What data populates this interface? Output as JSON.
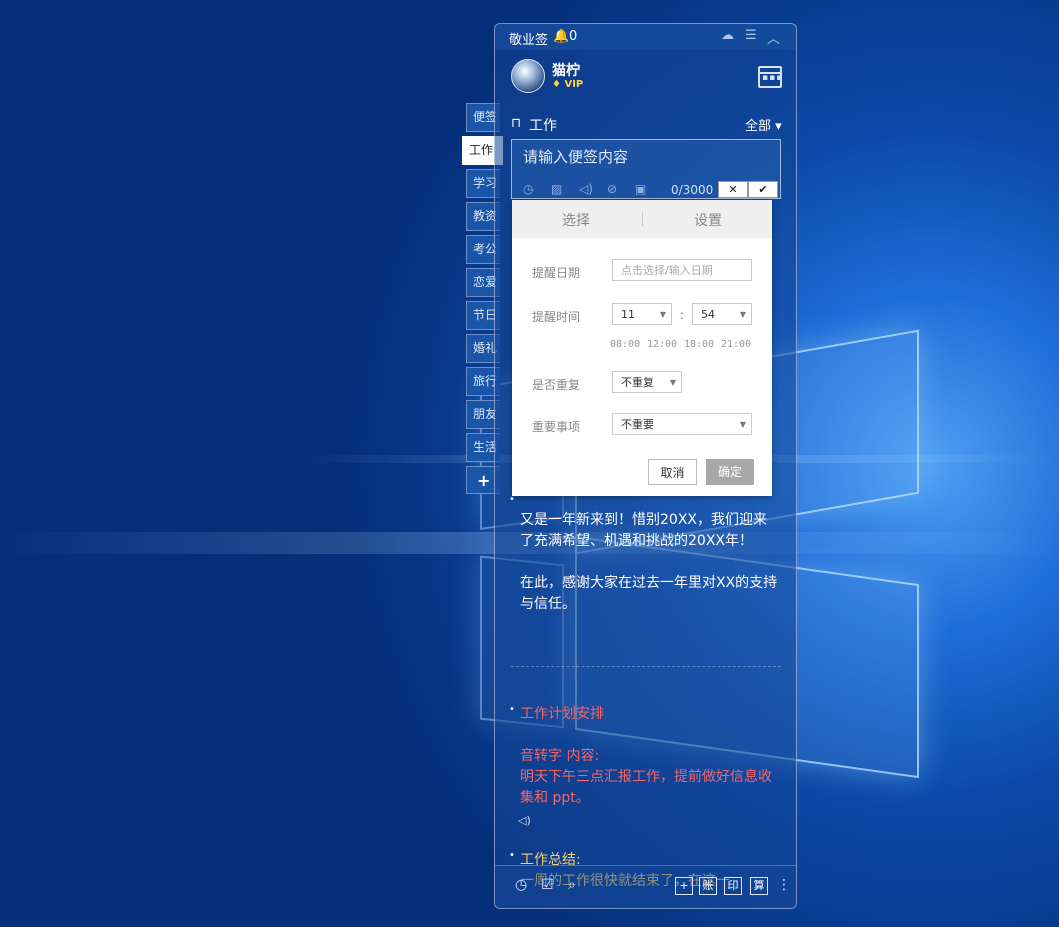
{
  "app": {
    "name": "敬业签",
    "notify_count": "0"
  },
  "user": {
    "name": "猫柠",
    "vip": "VIP"
  },
  "category": {
    "current": "工作",
    "filter": "全部"
  },
  "side_tabs": [
    "便签",
    "工作",
    "学习",
    "教资",
    "考公",
    "恋爱",
    "节日",
    "婚礼",
    "旅行",
    "朋友",
    "生活"
  ],
  "editor": {
    "placeholder": "请输入便签内容",
    "char_count": "0/3000"
  },
  "popup": {
    "tab_select": "选择",
    "tab_settings": "设置",
    "date_label": "提醒日期",
    "date_placeholder": "点击选择/输入日期",
    "time_label": "提醒时间",
    "hour": "11",
    "minute": "54",
    "colon": ":",
    "presets": [
      "08:00",
      "12:00",
      "18:00",
      "21:00"
    ],
    "repeat_label": "是否重复",
    "repeat_value": "不重复",
    "importance_label": "重要事项",
    "importance_value": "不重要",
    "cancel": "取消",
    "confirm": "确定"
  },
  "notes": {
    "note1_p1": "又是一年新来到！惜别20XX，我们迎来了充满希望、机遇和挑战的20XX年！",
    "note1_p2": "在此，感谢大家在过去一年里对XX的支持与信任。",
    "note2_title": "工作计划安排",
    "note2_l1": "音转字 内容:",
    "note2_l2": "明天下午三点汇报工作，提前做好信息收集和 ppt。",
    "note3_title": "工作总结:",
    "note3_l1": "一周的工作很快就结束了，在这一"
  },
  "bottom": {
    "btn_account": "账",
    "btn_print": "印",
    "btn_calc": "算",
    "btn_add": "+"
  }
}
